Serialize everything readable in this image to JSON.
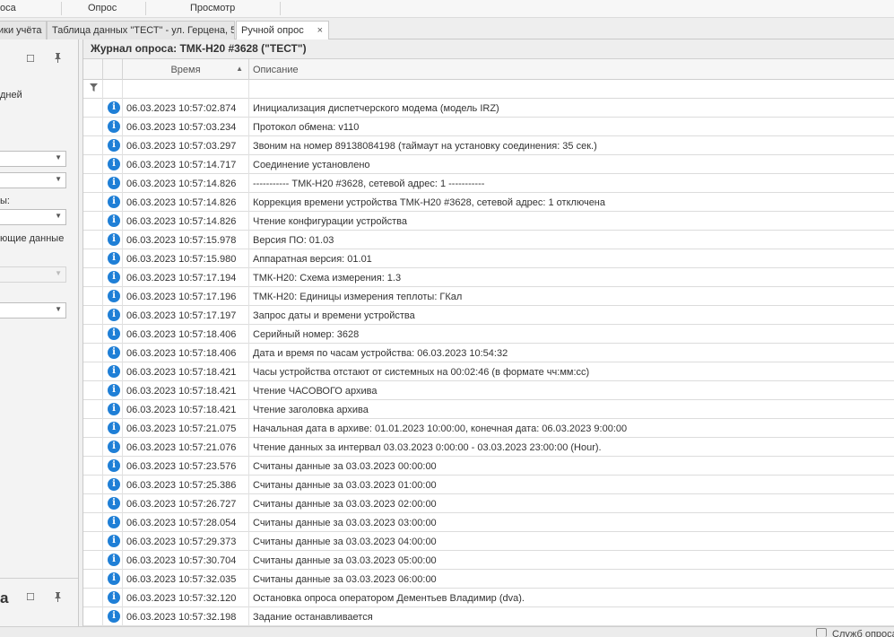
{
  "ribbon": {
    "groups": [
      "оса",
      "Опрос",
      "Просмотр"
    ]
  },
  "tabs": [
    {
      "label": "ики учёта"
    },
    {
      "label": "Таблица данных \"ТЕСТ\" - ул. Герцена, 5"
    },
    {
      "label": "Ручной опрос",
      "close": "×"
    }
  ],
  "left_panel": {
    "pin_icon": "pin-icon",
    "restore_icon": "restore-icon",
    "text_1": "дней",
    "text_2": "ы:",
    "text_3": "ющие данные",
    "bottom_label": "а"
  },
  "journal": {
    "title": "Журнал опроса: ТМК-Н20 #3628 (\"ТЕСТ\")",
    "columns": {
      "time": "Время",
      "description": "Описание"
    },
    "rows": [
      {
        "time": "06.03.2023 10:57:02.874",
        "desc": "Инициализация диспетчерского модема (модель IRZ)"
      },
      {
        "time": "06.03.2023 10:57:03.234",
        "desc": "Протокол обмена: v110"
      },
      {
        "time": "06.03.2023 10:57:03.297",
        "desc": "Звоним на номер 89138084198 (таймаут на установку соединения: 35 сек.)"
      },
      {
        "time": "06.03.2023 10:57:14.717",
        "desc": "Соединение установлено"
      },
      {
        "time": "06.03.2023 10:57:14.826",
        "desc": "----------- ТМК-Н20 #3628, сетевой адрес: 1 -----------"
      },
      {
        "time": "06.03.2023 10:57:14.826",
        "desc": "Коррекция времени устройства ТМК-Н20 #3628, сетевой адрес: 1 отключена"
      },
      {
        "time": "06.03.2023 10:57:14.826",
        "desc": "Чтение конфигурации устройства"
      },
      {
        "time": "06.03.2023 10:57:15.978",
        "desc": "Версия ПО: 01.03"
      },
      {
        "time": "06.03.2023 10:57:15.980",
        "desc": "Аппаратная версия: 01.01"
      },
      {
        "time": "06.03.2023 10:57:17.194",
        "desc": "ТМК-Н20: Схема измерения: 1.3"
      },
      {
        "time": "06.03.2023 10:57:17.196",
        "desc": "ТМК-Н20: Единицы измерения теплоты: ГКал"
      },
      {
        "time": "06.03.2023 10:57:17.197",
        "desc": "Запрос даты и времени устройства"
      },
      {
        "time": "06.03.2023 10:57:18.406",
        "desc": "Серийный номер: 3628"
      },
      {
        "time": "06.03.2023 10:57:18.406",
        "desc": "Дата и время по часам устройства: 06.03.2023 10:54:32"
      },
      {
        "time": "06.03.2023 10:57:18.421",
        "desc": "Часы устройства отстают от системных на 00:02:46 (в формате чч:мм:сс)"
      },
      {
        "time": "06.03.2023 10:57:18.421",
        "desc": "Чтение ЧАСОВОГО архива"
      },
      {
        "time": "06.03.2023 10:57:18.421",
        "desc": "Чтение заголовка архива"
      },
      {
        "time": "06.03.2023 10:57:21.075",
        "desc": "Начальная дата в архиве: 01.01.2023 10:00:00, конечная дата: 06.03.2023 9:00:00"
      },
      {
        "time": "06.03.2023 10:57:21.076",
        "desc": "Чтение данных за интервал 03.03.2023 0:00:00 - 03.03.2023 23:00:00 (Hour)."
      },
      {
        "time": "06.03.2023 10:57:23.576",
        "desc": "Считаны данные за 03.03.2023 00:00:00"
      },
      {
        "time": "06.03.2023 10:57:25.386",
        "desc": "Считаны данные за 03.03.2023 01:00:00"
      },
      {
        "time": "06.03.2023 10:57:26.727",
        "desc": "Считаны данные за 03.03.2023 02:00:00"
      },
      {
        "time": "06.03.2023 10:57:28.054",
        "desc": "Считаны данные за 03.03.2023 03:00:00"
      },
      {
        "time": "06.03.2023 10:57:29.373",
        "desc": "Считаны данные за 03.03.2023 04:00:00"
      },
      {
        "time": "06.03.2023 10:57:30.704",
        "desc": "Считаны данные за 03.03.2023 05:00:00"
      },
      {
        "time": "06.03.2023 10:57:32.035",
        "desc": "Считаны данные за 03.03.2023 06:00:00"
      },
      {
        "time": "06.03.2023 10:57:32.120",
        "desc": "Остановка опроса оператором Дементьев Владимир (dva)."
      },
      {
        "time": "06.03.2023 10:57:32.198",
        "desc": "Задание останавливается"
      }
    ]
  },
  "status": {
    "text": "Служб опроса"
  },
  "colors": {
    "info_icon": "#1f7fd6",
    "grid_line": "#dcdcdc"
  }
}
